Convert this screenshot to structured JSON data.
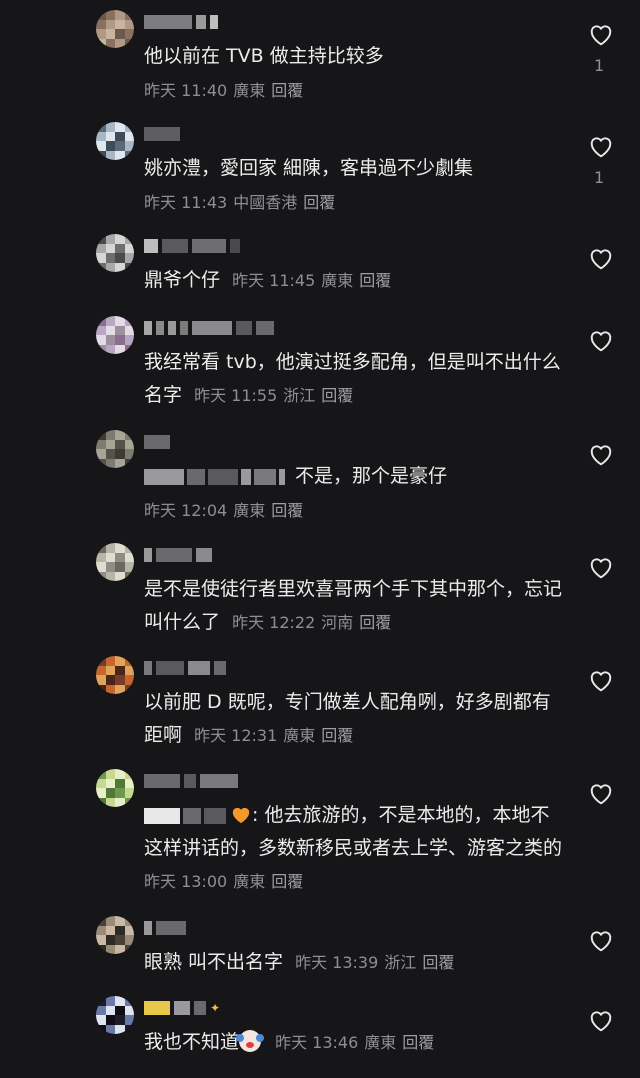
{
  "comments": [
    {
      "text": "他以前在 TVB 做主持比较多",
      "time": "昨天 11:40",
      "location": "廣東",
      "reply": "回覆",
      "likes": "1",
      "avatar": [
        "#6a5a4c",
        "#8a7060",
        "#b09a86",
        "#c9b4a0"
      ]
    },
    {
      "text": "姚亦澧，愛回家 細陳，客串過不少劇集",
      "time": "昨天 11:43",
      "location": "中國香港",
      "reply": "回覆",
      "likes": "1",
      "avatar": [
        "#5c6a78",
        "#a9b6c4",
        "#dfe6ee",
        "#3e4b58"
      ]
    },
    {
      "text": "鼎爷个仔",
      "time": "昨天 11:45",
      "location": "廣東",
      "reply": "回覆",
      "likes": "",
      "avatar": [
        "#4a4a4c",
        "#a8a8aa",
        "#d6d6d6",
        "#6e6e70"
      ]
    },
    {
      "text": "我经常看 tvb，他演过挺多配角，但是叫不出什么名字",
      "time": "昨天 11:55",
      "location": "浙江",
      "reply": "回覆",
      "likes": "",
      "avatar": [
        "#8a6f8c",
        "#b7a7c2",
        "#e4dbe7",
        "#9c8f9e"
      ]
    },
    {
      "text": "不是，那个是豪仔",
      "time": "昨天 12:04",
      "location": "廣東",
      "reply": "回覆",
      "likes": "",
      "avatar": [
        "#3d3b36",
        "#7d7a70",
        "#a8a596",
        "#55524a"
      ]
    },
    {
      "text": "是不是使徒行者里欢喜哥两个手下其中那个，忘记叫什么了",
      "time": "昨天 12:22",
      "location": "河南",
      "reply": "回覆",
      "likes": "",
      "avatar": [
        "#6b6a62",
        "#b7b5a8",
        "#e0ddd0",
        "#8f8d84"
      ]
    },
    {
      "text": "以前肥 D 既呢，专门做差人配角咧，好多剧都有距啊",
      "time": "昨天 12:31",
      "location": "廣東",
      "reply": "回覆",
      "likes": "",
      "avatar": [
        "#7a3a28",
        "#c4662e",
        "#e0a45a",
        "#4a2418"
      ]
    },
    {
      "text": "他去旅游的，不是本地的，本地不这样讲话的，多数新移民或者去上学、游客之类的",
      "time": "昨天 13:00",
      "location": "廣東",
      "reply": "回覆",
      "likes": "",
      "avatar": [
        "#6d9a4a",
        "#c8d890",
        "#e8eec8",
        "#4f7a36"
      ]
    },
    {
      "text": "眼熟 叫不出名字",
      "time": "昨天 13:39",
      "location": "浙江",
      "reply": "回覆",
      "likes": "",
      "avatar": [
        "#4a4038",
        "#9a8a78",
        "#c8b8a4",
        "#2e2a26"
      ]
    },
    {
      "text": "我也不知道",
      "time": "昨天 13:46",
      "location": "廣東",
      "reply": "回覆",
      "likes": "",
      "avatar": [
        "#1c1c28",
        "#6a7aa8",
        "#e0e4f0",
        "#0e0e14"
      ]
    }
  ],
  "colors": {
    "background": "#161618",
    "text": "#ececec",
    "meta": "#8e8e93",
    "like_outline": "#e8e8e8"
  },
  "icons": {
    "like": "heart-outline-icon"
  }
}
